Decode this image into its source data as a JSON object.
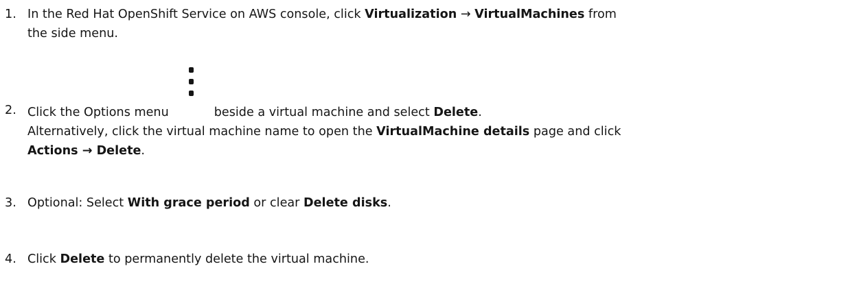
{
  "steps": [
    {
      "number": "1.",
      "t1": "In the Red Hat OpenShift Service on AWS console, click ",
      "b1": "Virtualization",
      "t2": " → ",
      "b2": "VirtualMachines",
      "t3": " from",
      "line2": "the side menu."
    },
    {
      "number": "2.",
      "t1": "Click the Options menu",
      "icon": "kebab-vertical-icon",
      "t2": "beside a virtual machine and select ",
      "b1": "Delete",
      "t3": ".",
      "alt_t1": "Alternatively, click the virtual machine name to open the ",
      "alt_b1": "VirtualMachine details",
      "alt_t2": " page and click",
      "alt_b2": "Actions → Delete",
      "alt_t3": "."
    },
    {
      "number": "3.",
      "t1": "Optional: Select ",
      "b1": "With grace period",
      "t2": " or clear ",
      "b2": "Delete disks",
      "t3": "."
    },
    {
      "number": "4.",
      "t1": "Click ",
      "b1": "Delete",
      "t2": " to permanently delete the virtual machine."
    }
  ],
  "colors": {
    "text": "#151515",
    "icon": "#151515"
  }
}
